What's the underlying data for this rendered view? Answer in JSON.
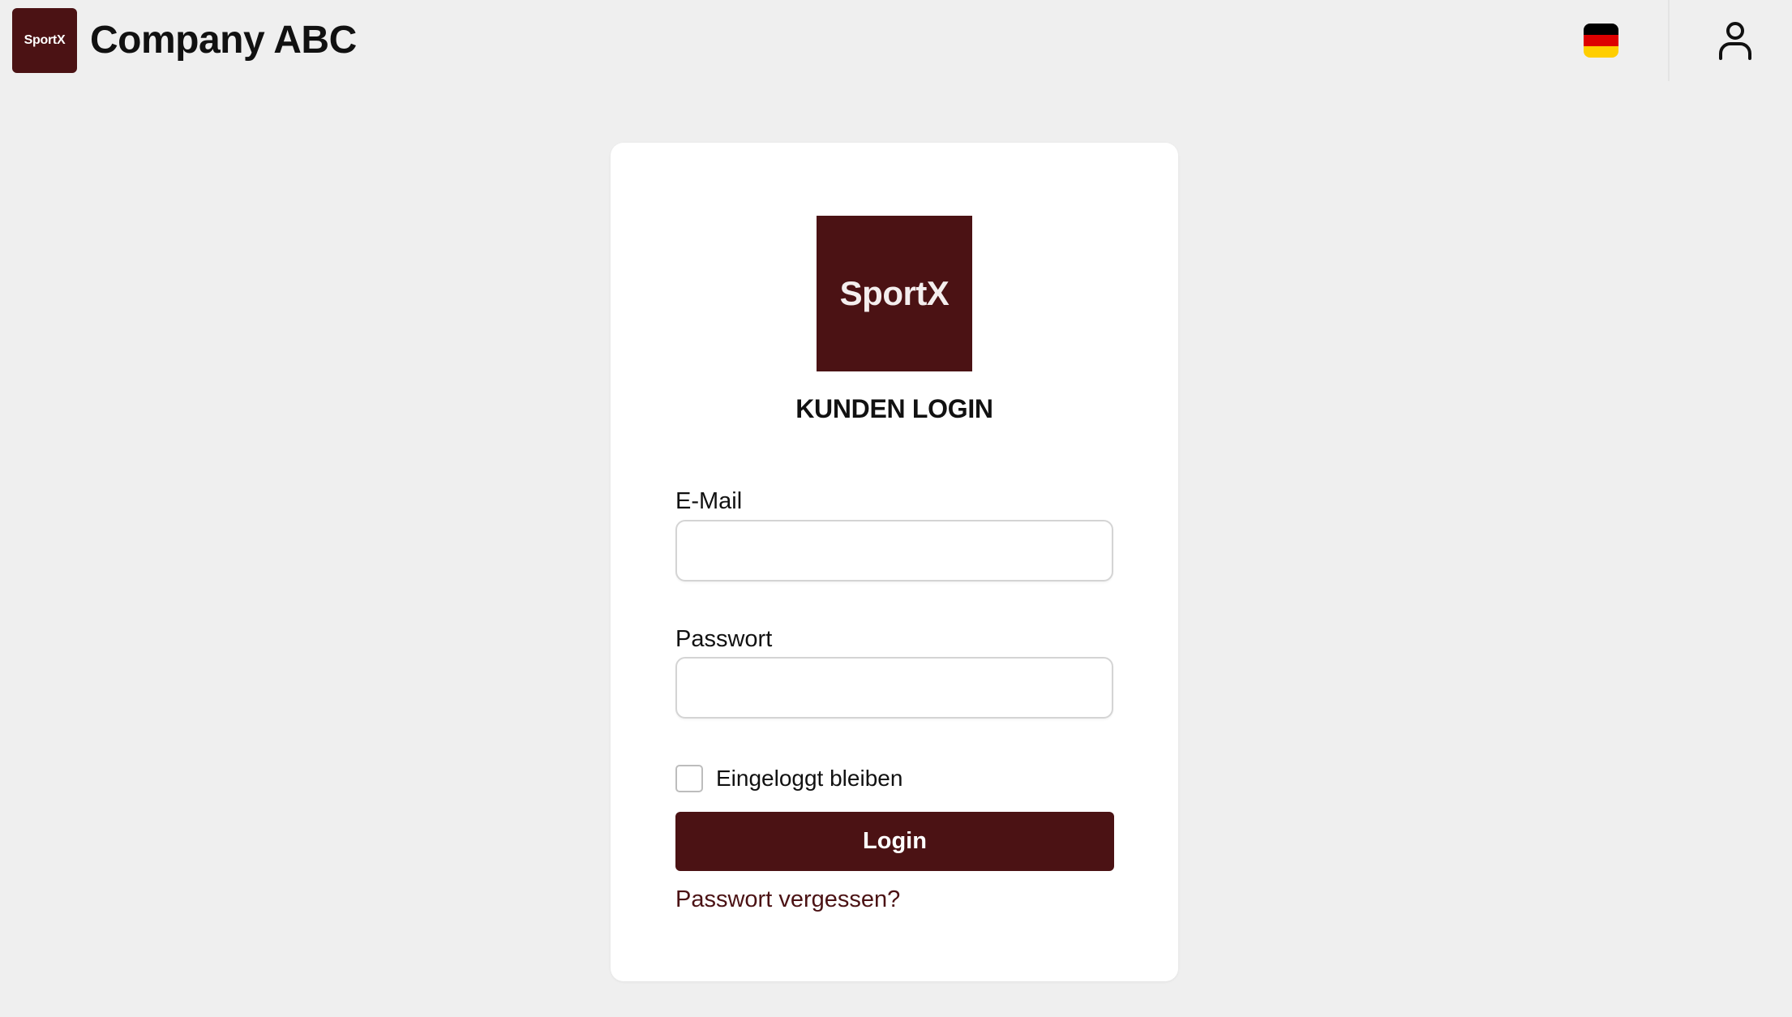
{
  "header": {
    "logo_text": "SportX",
    "company_name": "Company ABC",
    "language_flag": "de-flag-icon",
    "user_icon": "user-icon"
  },
  "login_card": {
    "logo_text": "SportX",
    "title": "KUNDEN LOGIN",
    "email_label": "E-Mail",
    "email_value": "",
    "password_label": "Passwort",
    "password_value": "",
    "remember_label": "Eingeloggt bleiben",
    "remember_checked": false,
    "login_button": "Login",
    "forgot_link": "Passwort vergessen?"
  },
  "colors": {
    "brand": "#4b1214",
    "background": "#efefef",
    "card": "#ffffff",
    "flag_black": "#000000",
    "flag_red": "#dd0000",
    "flag_gold": "#ffce00"
  }
}
